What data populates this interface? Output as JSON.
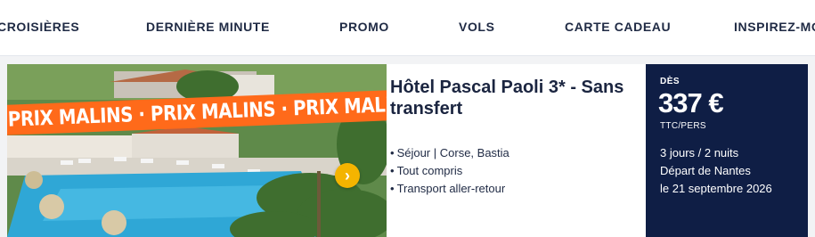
{
  "nav": {
    "items": [
      "CROISIÈRES",
      "DERNIÈRE MINUTE",
      "PROMO",
      "VOLS",
      "CARTE CADEAU",
      "INSPIREZ-MOI"
    ]
  },
  "offer": {
    "banner_text": "PRIX MALINS · PRIX MALINS · PRIX MALINS · PRIX MALINS · PRIX MALINS",
    "title": "Hôtel Pascal Paoli 3* - Sans transfert",
    "features": [
      "Séjour | Corse, Bastia",
      "Tout compris",
      "Transport aller-retour"
    ],
    "next_icon": "chevron-right-icon",
    "price": {
      "from_label": "DÈS",
      "amount": "337 €",
      "unit": "TTC/PERS",
      "duration": "3 jours / 2 nuits",
      "departure": "Départ de Nantes",
      "date": "le 21 septembre 2026"
    }
  },
  "colors": {
    "banner": "#ff6a1a",
    "price_box": "#0f1e45",
    "next_button": "#f4b400",
    "nav_text": "#1f2a44"
  }
}
